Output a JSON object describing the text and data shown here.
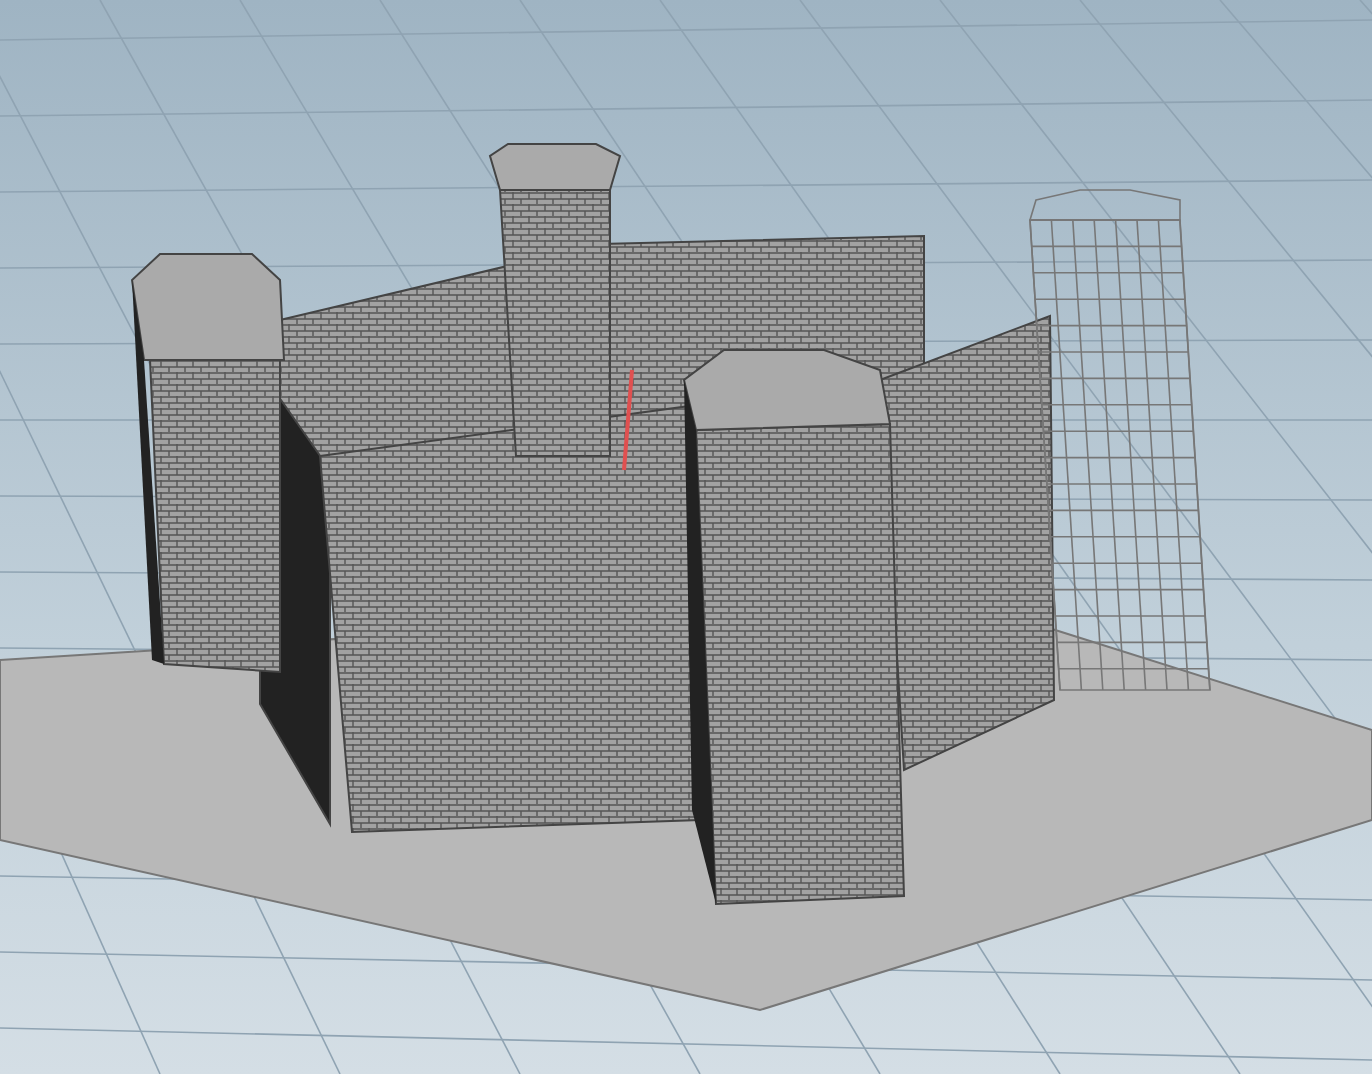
{
  "models": [
    {
      "kind": "solid"
    },
    {
      "kind": "wireframe"
    }
  ]
}
